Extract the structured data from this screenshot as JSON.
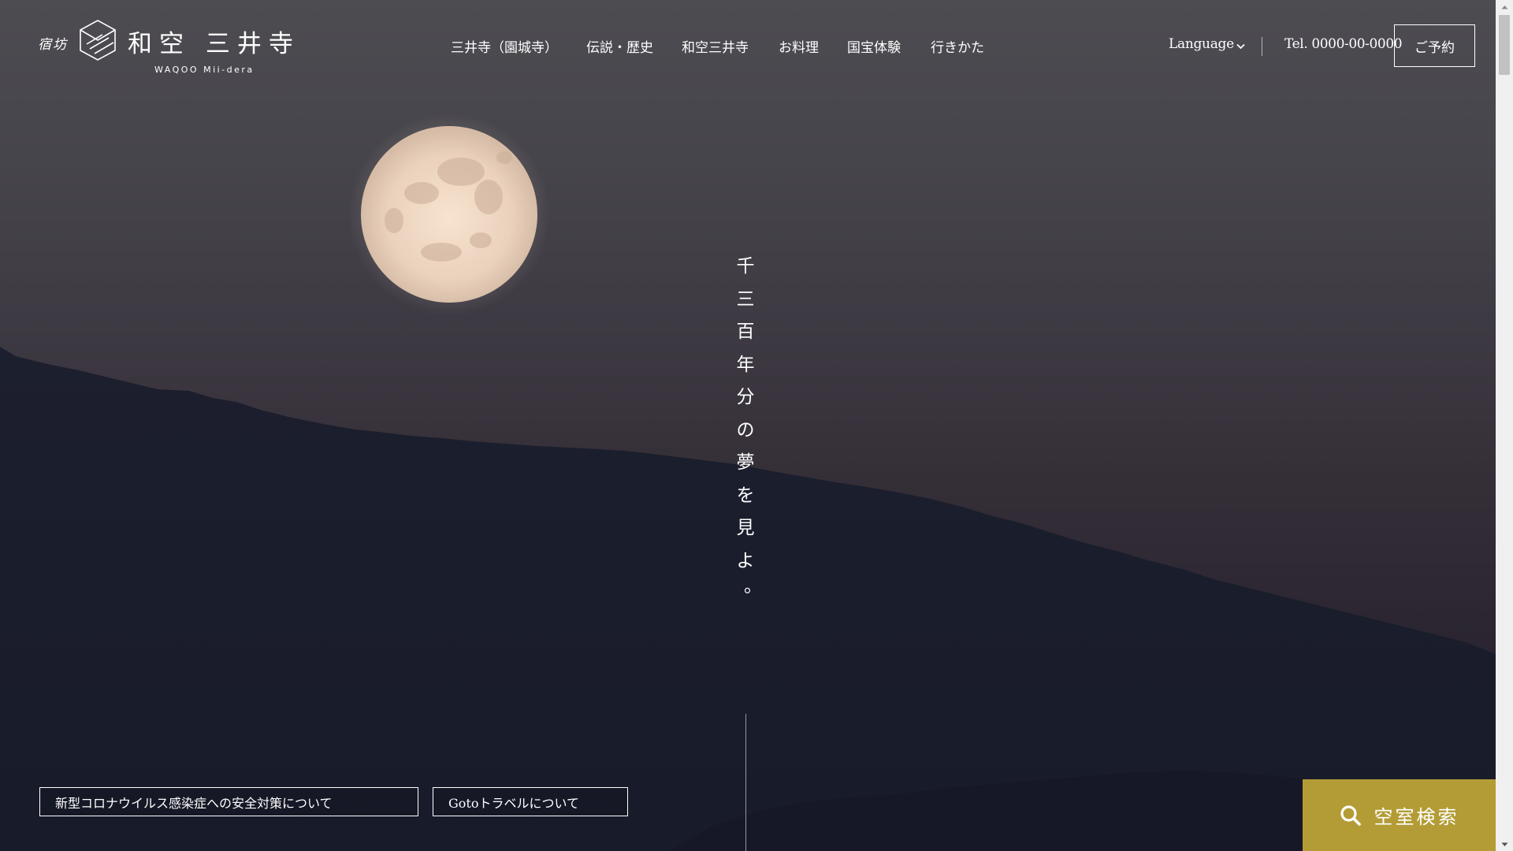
{
  "logo": {
    "small": "宿坊",
    "name": "和空 三井寺",
    "sub": "WAQOO Mii-dera"
  },
  "nav": {
    "items": [
      {
        "label": "三井寺（園城寺）"
      },
      {
        "label": "伝説・歴史"
      },
      {
        "label": "和空三井寺"
      },
      {
        "label": "お料理"
      },
      {
        "label": "国宝体験"
      },
      {
        "label": "行きかた"
      }
    ]
  },
  "header": {
    "language": "Language",
    "tel": "Tel. 0000-00-0000",
    "reserve": "ご予約"
  },
  "hero": {
    "copy": [
      "千",
      "三",
      "百",
      "年",
      "分",
      "の",
      "夢",
      "を",
      "見",
      "よ",
      "。"
    ]
  },
  "notices": {
    "covid": "新型コロナウイルス感染症への安全対策について",
    "goto": "Gotoトラベルについて"
  },
  "search": {
    "label": "空室検索"
  },
  "colors": {
    "accent": "#b39c35",
    "sky": "#47454c",
    "mountain": "#1a1d2c"
  }
}
